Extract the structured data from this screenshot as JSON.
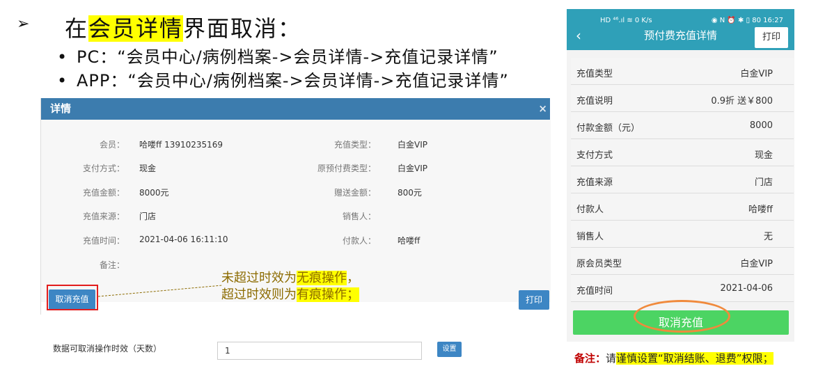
{
  "slide": {
    "arrow": "➢",
    "heading_pre": "在",
    "heading_hl": "会员详情",
    "heading_post": "界面取消：",
    "bullets": [
      "PC：“会员中心/病例档案->会员详情->充值记录详情”",
      "APP：“会员中心/病例档案->会员详情->充值记录详情”"
    ]
  },
  "pc": {
    "title": "详情",
    "close": "×",
    "fields": [
      {
        "label": "会员：",
        "value": "哈喽ff 13910235169"
      },
      {
        "label": "充值类型：",
        "value": "白金VIP"
      },
      {
        "label": "支付方式：",
        "value": "现金"
      },
      {
        "label": "原预付费类型：",
        "value": "白金VIP"
      },
      {
        "label": "充值金额：",
        "value": "8000元"
      },
      {
        "label": "赠送金额：",
        "value": "800元"
      },
      {
        "label": "充值来源：",
        "value": "门店"
      },
      {
        "label": "销售人：",
        "value": ""
      },
      {
        "label": "充值时间：",
        "value": "2021-04-06 16:11:10"
      },
      {
        "label": "付款人：",
        "value": "哈喽ff"
      },
      {
        "label": "备注：",
        "value": ""
      }
    ],
    "cancel_button": "取消充值",
    "print_button": "打印",
    "setting_label": "数据可取消操作时效（天数）",
    "setting_value": "1",
    "setting_button": "设置"
  },
  "callout": {
    "line1_pre": "未超过时效为",
    "line1_hl": "无痕操作",
    "line1_post": "，",
    "line2_pre": "超过时效则为",
    "line2_hl": "有痕操作；"
  },
  "app": {
    "status_left": "HD ⁴⁶.ıl ≋ 0 K/s",
    "status_right": "◉ N ⏰ ✱ ▯ 80 16:27",
    "back": "‹",
    "title": "预付费充值详情",
    "print_button": "打印",
    "rows": [
      {
        "key": "充值类型",
        "value": "白金VIP"
      },
      {
        "key": "充值说明",
        "value": "0.9折 送￥800"
      },
      {
        "key": "付款金额（元）",
        "value": "8000"
      },
      {
        "key": "支付方式",
        "value": "现金"
      },
      {
        "key": "充值来源",
        "value": "门店"
      },
      {
        "key": "付款人",
        "value": "哈喽ff"
      },
      {
        "key": "销售人",
        "value": "无"
      },
      {
        "key": "原会员类型",
        "value": "白金VIP"
      },
      {
        "key": "充值时间",
        "value": "2021-04-06"
      }
    ],
    "cancel_button": "取消充值"
  },
  "note": {
    "label": "备注：",
    "pre": "请",
    "hl": "谨慎设置“取消结账、退费”权限；"
  },
  "colors": {
    "modal_header": "#3c7cae",
    "button_blue": "#3d86c4",
    "app_header": "#2fa0b8",
    "app_cancel": "#4cd463",
    "highlight": "#ffff00",
    "red_frame": "#e21c1c",
    "orange_oval": "#f08a3c"
  }
}
